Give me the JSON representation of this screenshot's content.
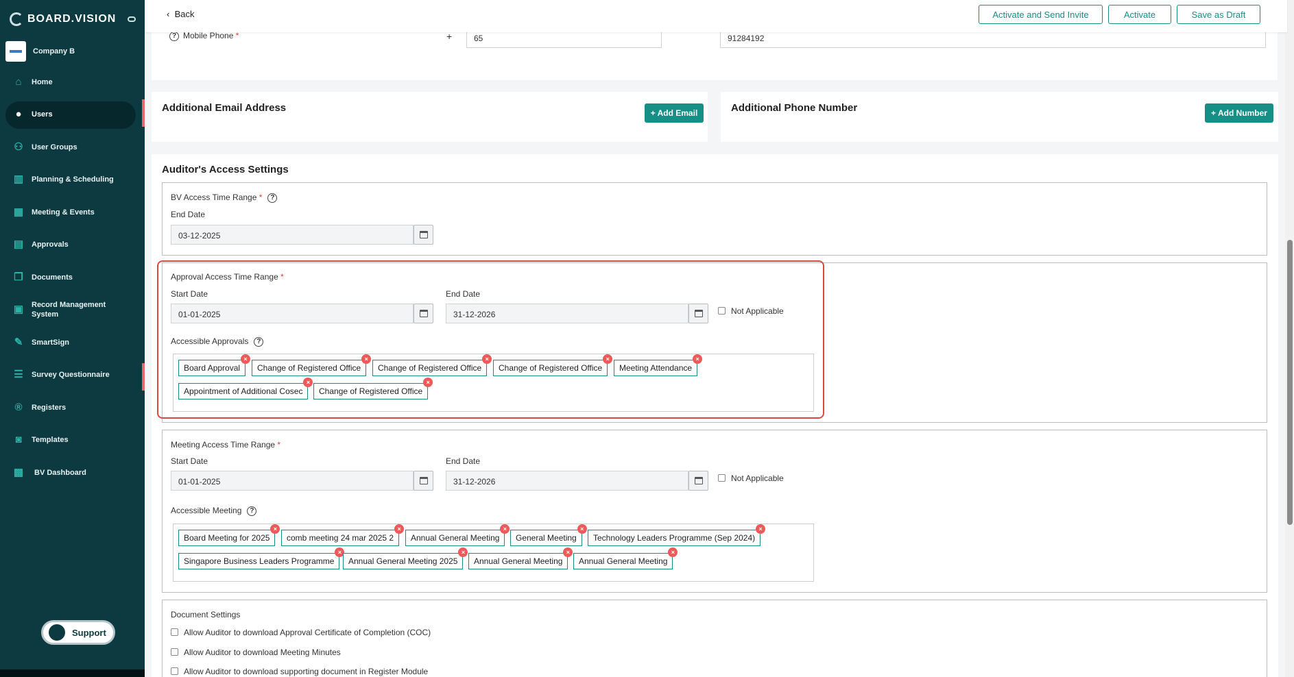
{
  "brand": "BOARD.VISION",
  "company": "Company B",
  "sidebar": {
    "items": [
      {
        "label": "Home",
        "icon": "home-icon"
      },
      {
        "label": "Users",
        "icon": "user-icon",
        "active": true
      },
      {
        "label": "User Groups",
        "icon": "users-icon"
      },
      {
        "label": "Planning & Scheduling",
        "icon": "chart-icon"
      },
      {
        "label": "Meeting & Events",
        "icon": "calendar-icon"
      },
      {
        "label": "Approvals",
        "icon": "approval-icon"
      },
      {
        "label": "Documents",
        "icon": "documents-icon"
      },
      {
        "label": "Record Management System",
        "icon": "record-icon"
      },
      {
        "label": "SmartSign",
        "icon": "pen-icon"
      },
      {
        "label": "Survey Questionnaire",
        "icon": "survey-icon"
      },
      {
        "label": "Registers",
        "icon": "registers-icon"
      },
      {
        "label": "Templates",
        "icon": "templates-icon"
      },
      {
        "label": "BV Dashboard",
        "icon": "dashboard-icon"
      }
    ],
    "support_label": "Support"
  },
  "topbar": {
    "back_label": "Back",
    "activate_send_label": "Activate and Send Invite",
    "activate_label": "Activate",
    "save_draft_label": "Save as Draft"
  },
  "mobile": {
    "label": "Mobile Phone",
    "plus": "+",
    "country_code": "65",
    "number": "91284192"
  },
  "additional_email": {
    "title": "Additional Email Address",
    "button": "+ Add Email"
  },
  "additional_phone": {
    "title": "Additional Phone Number",
    "button": "+ Add Number"
  },
  "auditor": {
    "title": "Auditor's Access Settings",
    "bv_range": {
      "label": "BV Access Time Range",
      "end_label": "End Date",
      "end_value": "03-12-2025"
    },
    "approval_range": {
      "label": "Approval Access Time Range",
      "start_label": "Start Date",
      "start_value": "01-01-2025",
      "end_label": "End Date",
      "end_value": "31-12-2026",
      "na_label": "Not Applicable",
      "accessible_label": "Accessible Approvals",
      "tags": [
        "Board Approval",
        "Change of Registered Office",
        "Change of Registered Office",
        "Change of Registered Office",
        "Meeting Attendance",
        "Appointment of Additional Cosec",
        "Change of Registered Office"
      ]
    },
    "meeting_range": {
      "label": "Meeting Access Time Range",
      "start_label": "Start Date",
      "start_value": "01-01-2025",
      "end_label": "End Date",
      "end_value": "31-12-2026",
      "na_label": "Not Applicable",
      "accessible_label": "Accessible Meeting",
      "tags": [
        "Board Meeting for 2025",
        "comb meeting 24 mar 2025 2",
        "Annual General Meeting",
        "General Meeting",
        "Technology Leaders Programme (Sep 2024)",
        "Singapore Business Leaders Programme",
        "Annual General Meeting 2025",
        "Annual General Meeting",
        "Annual General Meeting"
      ]
    },
    "documents": {
      "label": "Document Settings",
      "options": [
        "Allow Auditor to download Approval Certificate of Completion (COC)",
        "Allow Auditor to download Meeting Minutes",
        "Allow Auditor to download supporting document in Register Module"
      ]
    }
  },
  "colors": {
    "sidebar": "#0c3a40",
    "accent": "#168f87",
    "highlight": "#d94a45",
    "remove": "#ee5a5a"
  }
}
